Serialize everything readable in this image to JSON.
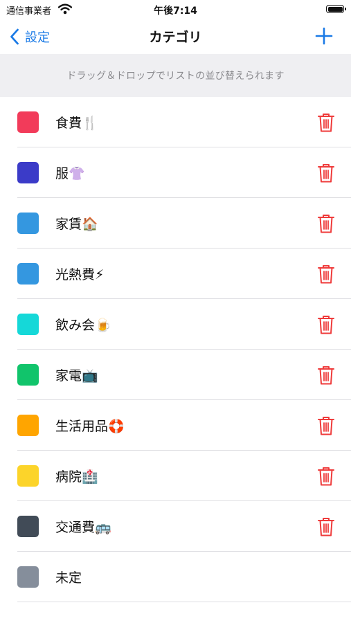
{
  "status_bar": {
    "carrier": "通信事業者",
    "time": "午後7:14"
  },
  "nav": {
    "back_label": "設定",
    "title": "カテゴリ"
  },
  "hint": "ドラッグ＆ドロップでリストの並び替えられます",
  "categories": [
    {
      "label": "食費🍴",
      "color": "#f23b5a",
      "deletable": true
    },
    {
      "label": "服👚",
      "color": "#3b3bc8",
      "deletable": true
    },
    {
      "label": "家賃🏠",
      "color": "#3497e0",
      "deletable": true
    },
    {
      "label": "光熱費⚡",
      "color": "#3497e0",
      "deletable": true
    },
    {
      "label": "飲み会🍺",
      "color": "#15d8d8",
      "deletable": true
    },
    {
      "label": "家電📺",
      "color": "#11c46b",
      "deletable": true
    },
    {
      "label": "生活用品🛟",
      "color": "#ffa500",
      "deletable": true
    },
    {
      "label": "病院🏥",
      "color": "#fcd42a",
      "deletable": true
    },
    {
      "label": "交通費🚌",
      "color": "#414b57",
      "deletable": true
    },
    {
      "label": "未定",
      "color": "#858e9b",
      "deletable": false
    }
  ],
  "colors": {
    "accent": "#1a7ae6",
    "delete": "#ef3b3b"
  },
  "icons": {
    "back": "chevron-left-icon",
    "add": "plus-icon",
    "delete": "trash-icon",
    "wifi": "wifi-icon",
    "battery": "battery-icon"
  }
}
